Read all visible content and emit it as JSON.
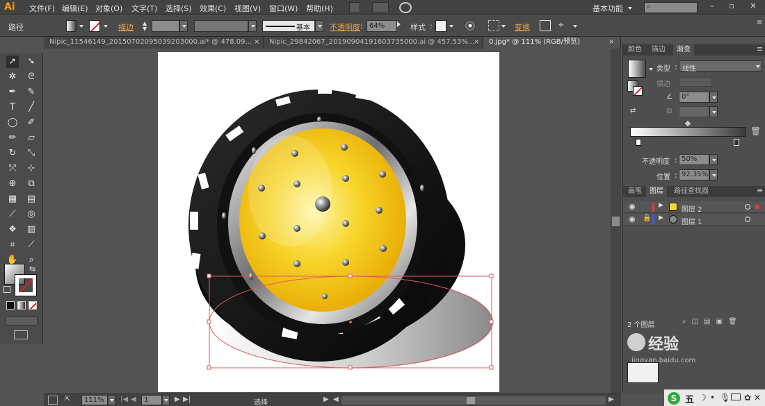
{
  "app": {
    "logo": "Ai"
  },
  "menu": [
    "文件(F)",
    "编辑(E)",
    "对象(O)",
    "文字(T)",
    "选择(S)",
    "效果(C)",
    "视图(V)",
    "窗口(W)",
    "帮助(H)"
  ],
  "topright": {
    "workspace": "基本功能",
    "search_placeholder": ""
  },
  "control": {
    "object_type": "路径",
    "stroke_label": "描边",
    "stroke_style": "基本",
    "opacity_label": "不透明度",
    "opacity_value": "64%",
    "style_label": "样式",
    "transform_label": "变换"
  },
  "tabs": [
    {
      "label": "Nipic_11546149_20150702095039203000.ai* @ 478.09...",
      "close": "×"
    },
    {
      "label": "Nipic_29842067_20190904191603735000.ai @ 457.53%...",
      "close": "×"
    },
    {
      "label": "0.jpg* @ 111% (RGB/预览)",
      "close": "×",
      "active": true
    }
  ],
  "gradient_panel": {
    "tabs": [
      "颜色",
      "描边",
      "渐变"
    ],
    "type_label": "类型",
    "type_value": "线性",
    "stroke_label": "描边",
    "angle_value": "0°",
    "opacity_label": "不透明度",
    "opacity_value": "50%",
    "position_label": "位置",
    "position_value": "92.35%"
  },
  "layers_panel": {
    "tabs": [
      "画笔",
      "图层",
      "路径查找器"
    ],
    "layers": [
      {
        "name": "图层 2",
        "color": "#e23b3b"
      },
      {
        "name": "图层 1",
        "color": "#3b5fe2"
      }
    ],
    "count": "2 个图层"
  },
  "status": {
    "zoom": "111%",
    "page": "1",
    "tool": "选择"
  },
  "watermark": {
    "text": "经验",
    "url": "jingyan.baidu.com"
  },
  "ime": {
    "label": "五"
  },
  "colors": {
    "accent": "#ff9a00",
    "yellow": "#f7d52a",
    "dark": "#141414",
    "selection": "#e05a5a"
  }
}
